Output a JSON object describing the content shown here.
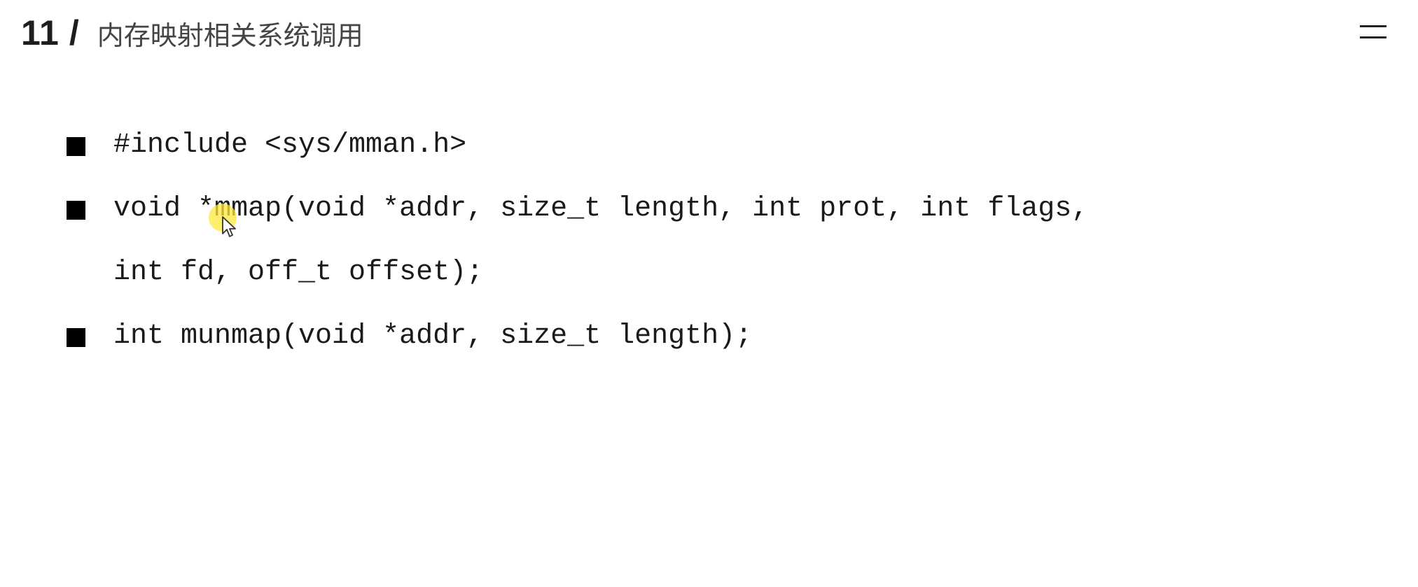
{
  "slide": {
    "number": "11",
    "separator": "/",
    "title": "内存映射相关系统调用"
  },
  "menu": {
    "icon": "menu-icon"
  },
  "bullets": [
    {
      "lines": [
        "#include <sys/mman.h>"
      ]
    },
    {
      "lines": [
        "void *mmap(void *addr, size_t length, int prot, int flags,",
        "int fd, off_t offset);"
      ]
    },
    {
      "lines": [
        "int munmap(void *addr, size_t length);"
      ]
    }
  ],
  "cursor": {
    "icon": "mouse-pointer-icon",
    "highlight_color": "#ffe83c"
  }
}
